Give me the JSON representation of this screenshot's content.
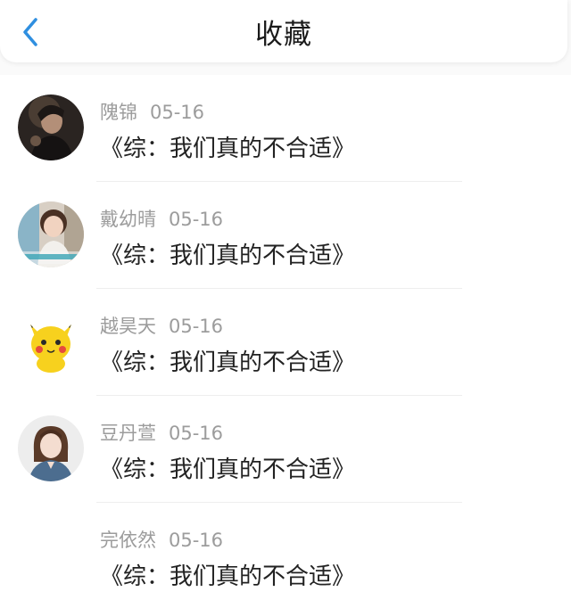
{
  "header": {
    "title": "收藏",
    "back_icon": "chevron-left-icon",
    "accent": "#2f8fe0"
  },
  "items": [
    {
      "name": "隗锦",
      "date": "05-16",
      "book": "《综：我们真的不合适》",
      "avatar": "avatar-dark-portrait"
    },
    {
      "name": "戴幼晴",
      "date": "05-16",
      "book": "《综：我们真的不合适》",
      "avatar": "avatar-girl-photo"
    },
    {
      "name": "越昊天",
      "date": "05-16",
      "book": "《综：我们真的不合适》",
      "avatar": "avatar-pikachu"
    },
    {
      "name": "豆丹萱",
      "date": "05-16",
      "book": "《综：我们真的不合适》",
      "avatar": "avatar-girl-denim"
    },
    {
      "name": "完依然",
      "date": "05-16",
      "book": "《综：我们真的不合适》",
      "avatar": ""
    }
  ]
}
